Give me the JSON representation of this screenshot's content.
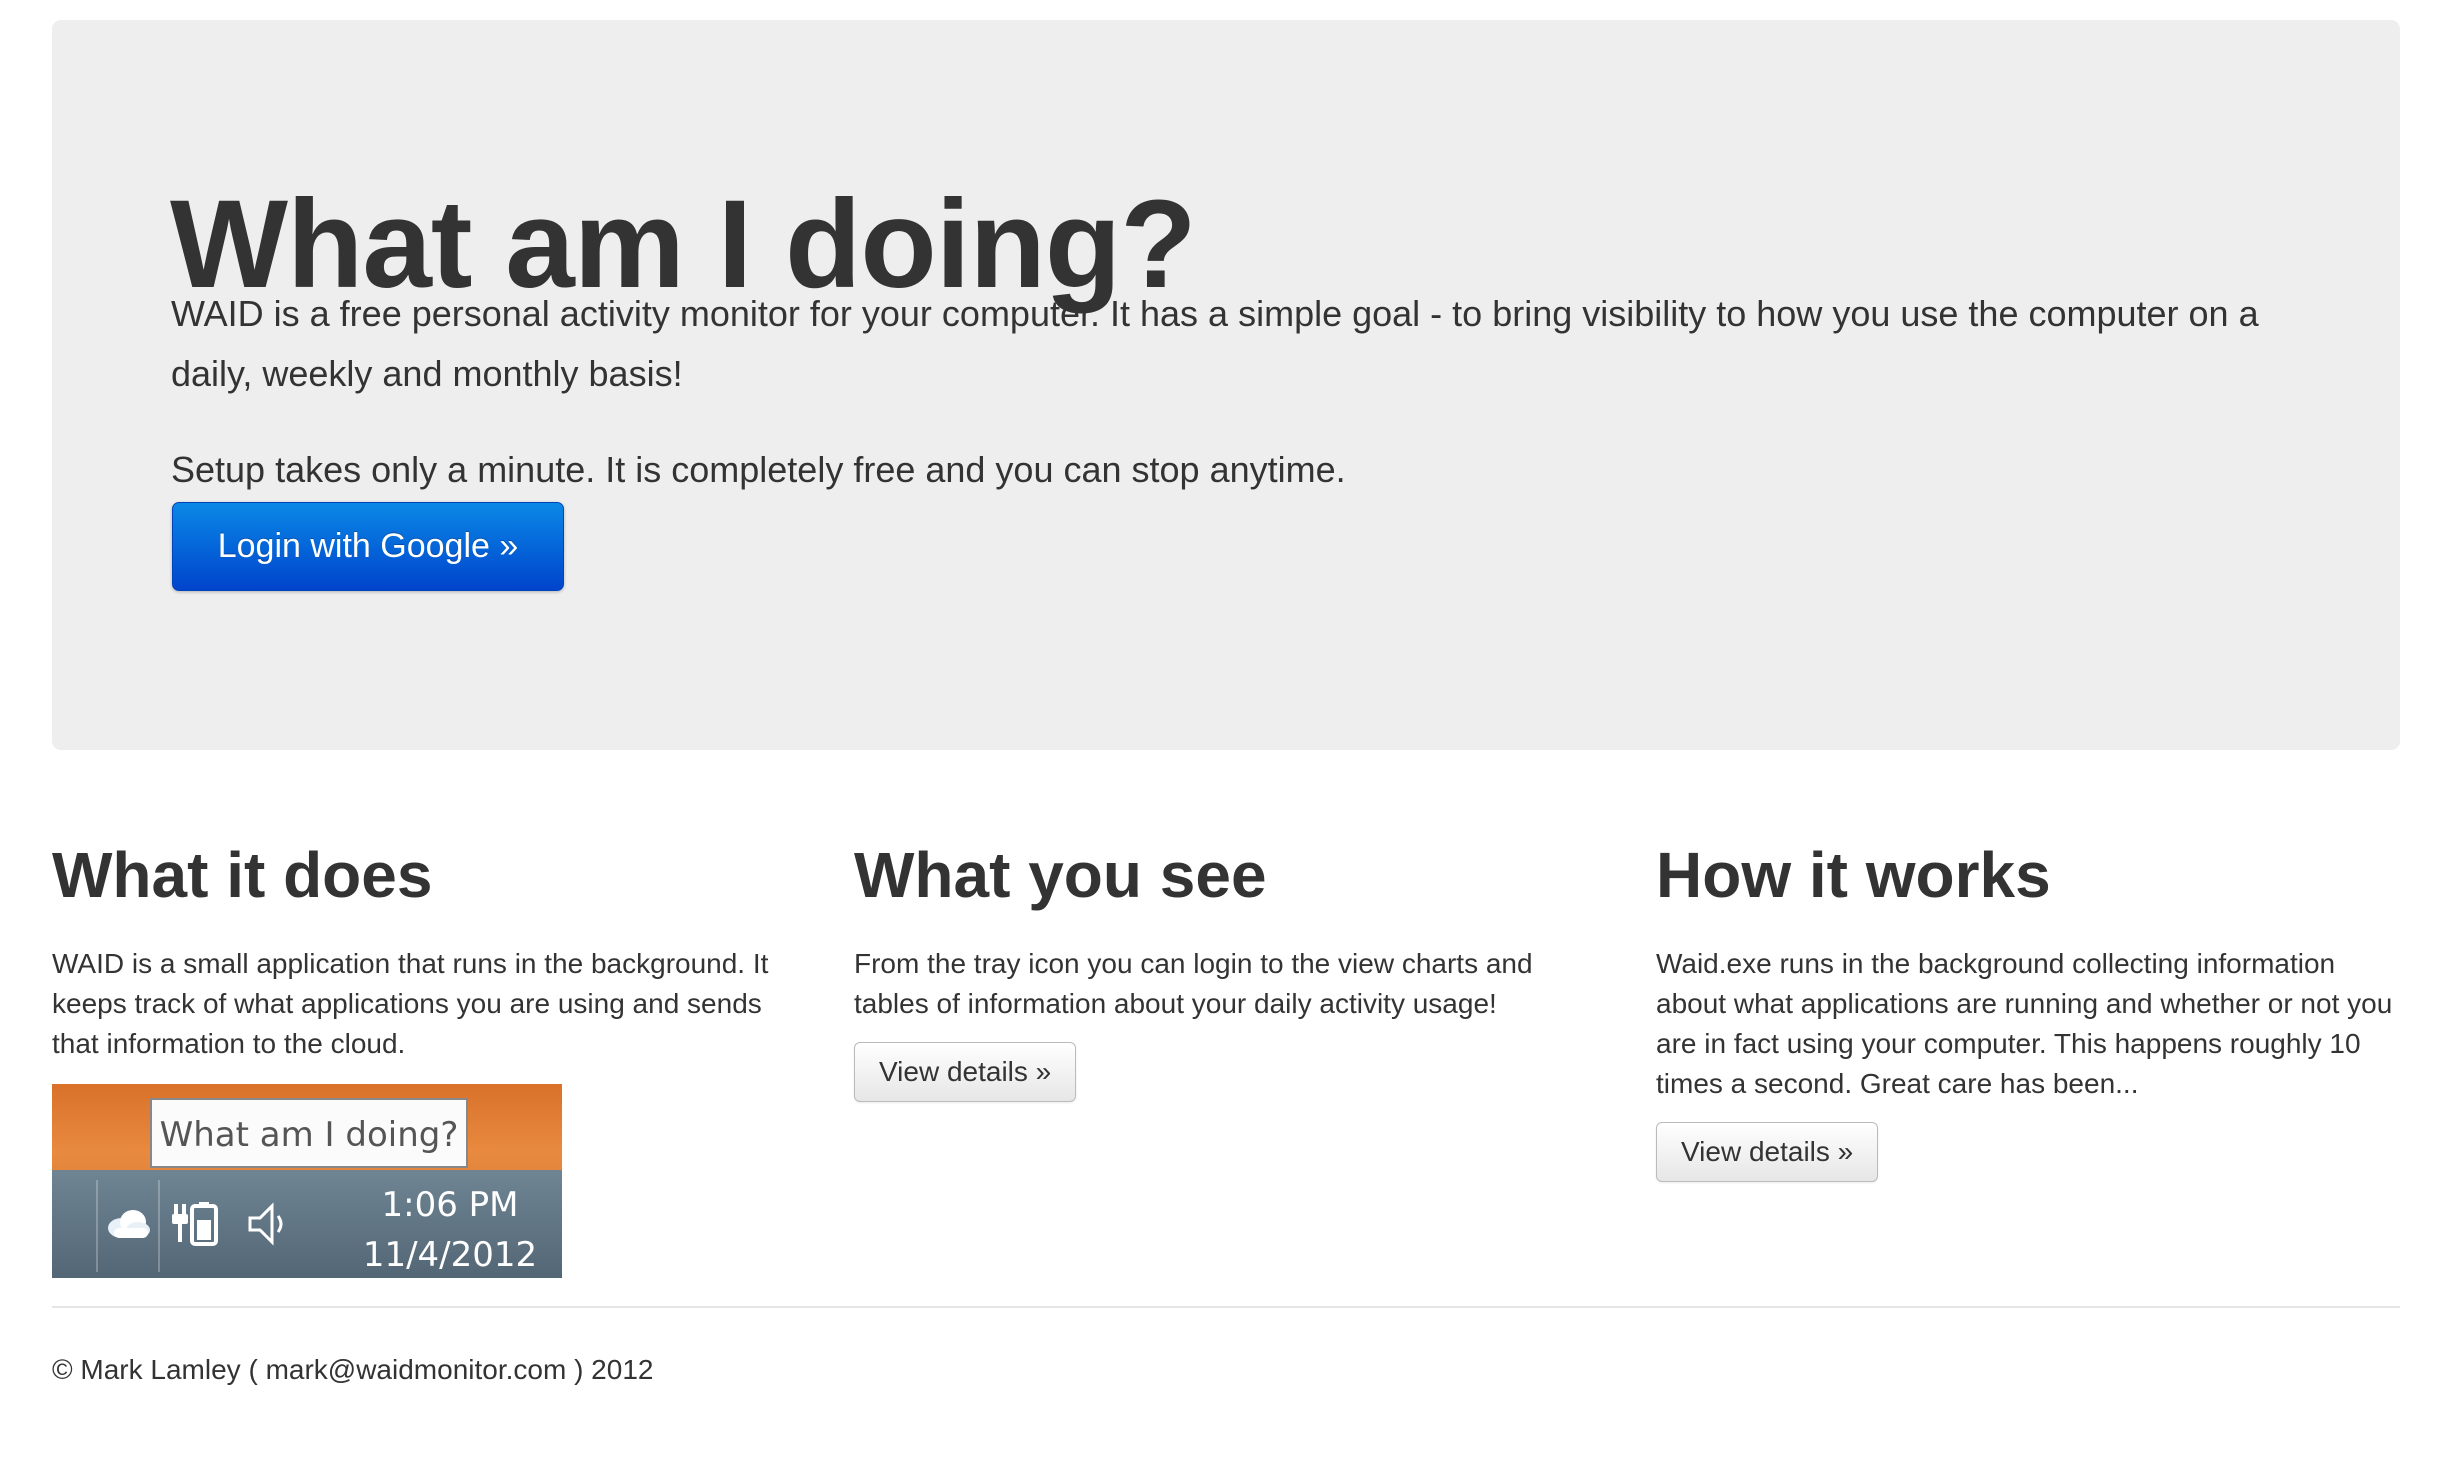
{
  "hero": {
    "title": "What am I doing?",
    "lead": "WAID is a free personal activity monitor for your computer. It has a simple goal - to bring visibility to how you use the computer on a daily, weekly and monthly basis!",
    "lead2": "Setup takes only a minute. It is completely free and you can stop anytime.",
    "login_button": "Login with Google »",
    "button_color": "#0a6fd8"
  },
  "columns": [
    {
      "heading": "What it does",
      "text": "WAID is a small application that runs in the background. It keeps track of what applications you are using and sends that information to the cloud."
    },
    {
      "heading": "What you see",
      "text": "From the tray icon you can login to the view charts and tables of information about your daily activity usage!",
      "button": "View details »"
    },
    {
      "heading": "How it works",
      "text": "Waid.exe runs in the background collecting information about what applications are running and whether or not you are in fact using your computer. This happens roughly 10 times a second. Great care has been...",
      "button": "View details »"
    }
  ],
  "tray": {
    "tooltip": "What am I doing?",
    "time": "1:06 PM",
    "date": "11/4/2012",
    "icons": [
      "cloud-icon",
      "battery-icon",
      "speaker-icon"
    ]
  },
  "footer": {
    "prefix": "© Mark Lamley (",
    "email": "mark@waidmonitor.com",
    "suffix": ") 2012"
  }
}
